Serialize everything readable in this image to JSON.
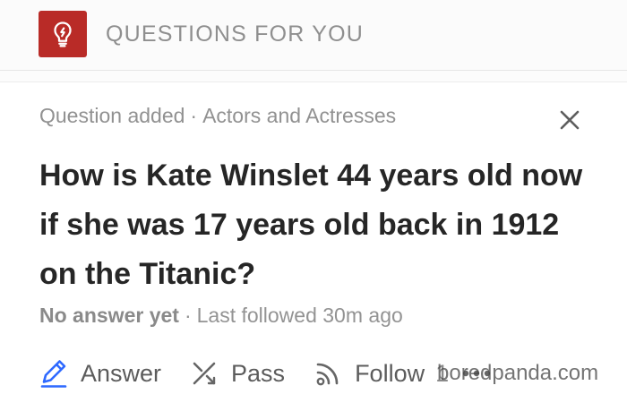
{
  "header": {
    "title": "QUESTIONS FOR YOU",
    "icon": "lightbulb-icon",
    "accent_color": "#b92b27"
  },
  "question_card": {
    "meta": {
      "label": "Question added",
      "separator": "·",
      "topic": "Actors and Actresses"
    },
    "close_icon": "close-icon",
    "question_text": "How is Kate Winslet 44 years old now if she was 17 years old back in 1912 on the Titanic?",
    "status": {
      "answer_status": "No answer yet",
      "separator": "·",
      "last_followed": "Last followed 30m ago"
    },
    "actions": {
      "answer": {
        "label": "Answer",
        "icon": "pencil-icon",
        "icon_color": "#2e69ff"
      },
      "pass": {
        "label": "Pass",
        "icon": "pass-icon"
      },
      "follow": {
        "label": "Follow",
        "icon": "follow-icon",
        "count": "1"
      },
      "more_icon": "more-icon"
    }
  },
  "watermark": "boredpanda.com"
}
